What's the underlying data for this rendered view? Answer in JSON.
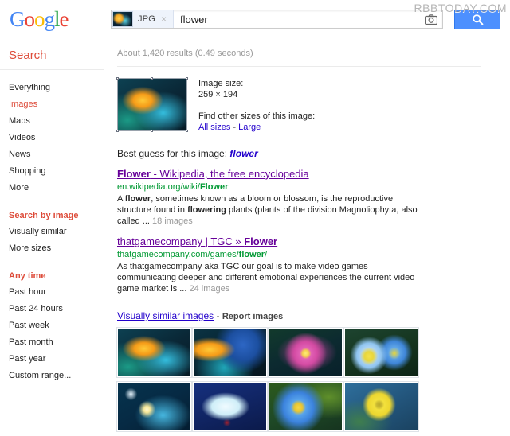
{
  "header": {
    "logo_text": "Google",
    "logo_letters": [
      {
        "ch": "G",
        "color": "#4285f4"
      },
      {
        "ch": "o",
        "color": "#ea4335"
      },
      {
        "ch": "o",
        "color": "#fbbc05"
      },
      {
        "ch": "g",
        "color": "#4285f4"
      },
      {
        "ch": "l",
        "color": "#34a853"
      },
      {
        "ch": "e",
        "color": "#ea4335"
      }
    ],
    "watermark": "RBBTODAY.COM",
    "search": {
      "chip_label": "JPG",
      "chip_close": "×",
      "query": "flower",
      "placeholder": "Search",
      "camera_icon": "camera-icon",
      "button_icon": "magnifier-icon",
      "button_color": "#4d90fe"
    }
  },
  "sidebar": {
    "heading": "Search",
    "nav_items": [
      {
        "label": "Everything",
        "active": false
      },
      {
        "label": "Images",
        "active": true
      },
      {
        "label": "Maps",
        "active": false
      },
      {
        "label": "Videos",
        "active": false
      },
      {
        "label": "News",
        "active": false
      },
      {
        "label": "Shopping",
        "active": false
      },
      {
        "label": "More",
        "active": false
      }
    ],
    "groups": [
      {
        "title": "Search by image",
        "items": [
          "Visually similar",
          "More sizes"
        ]
      },
      {
        "title": "Any time",
        "items": [
          "Past hour",
          "Past 24 hours",
          "Past week",
          "Past month",
          "Past year",
          "Custom range..."
        ]
      }
    ]
  },
  "main": {
    "result_stats": "About 1,420 results (0.49 seconds)",
    "image_card": {
      "size_label": "Image size:",
      "size_value": "259 × 194",
      "other_sizes_label": "Find other sizes of this image:",
      "all_sizes_link": "All sizes",
      "link_separator": " - ",
      "large_link": "Large"
    },
    "best_guess": {
      "label": "Best guess for this image:",
      "term": "flower"
    },
    "results": [
      {
        "title_prefix": "Flower",
        "title_rest": " - Wikipedia, the free encyclopedia",
        "url_plain": "en.wikipedia.org/wiki/",
        "url_bold": "Flower",
        "snippet_1": "A ",
        "snippet_b1": "flower",
        "snippet_2": ", sometimes known as a bloom or blossom, is the reproductive structure found in ",
        "snippet_b2": "flowering",
        "snippet_3": " plants (plants of the division Magnoliophyta, also called ... ",
        "image_count": "18 images"
      },
      {
        "title_prefix": "thatgamecompany | TGC » ",
        "title_rest": "Flower",
        "url_plain": "thatgamecompany.com/games/",
        "url_bold": "flower",
        "url_suffix": "/",
        "snippet_1": "As thatgamecompany aka TGC our goal is to make video games communicating deeper and different emotional experiences the current video game market is ... ",
        "image_count": "24 images"
      }
    ],
    "visually_similar": {
      "heading": "Visually similar images",
      "separator": " - ",
      "report_link": "Report images",
      "thumbnails": [
        {
          "alt": "bird-of-paradise flower",
          "style": "t1"
        },
        {
          "alt": "blue macaw with bird-of-paradise flower",
          "style": "t2"
        },
        {
          "alt": "pink lotus flower",
          "style": "t3"
        },
        {
          "alt": "blue and yellow pansies",
          "style": "t4"
        },
        {
          "alt": "glowing star burst artwork",
          "style": "t5"
        },
        {
          "alt": "white calla lily on blue",
          "style": "t6"
        },
        {
          "alt": "blue poppy flower",
          "style": "t7"
        },
        {
          "alt": "yellow sunflower on blue",
          "style": "t8"
        }
      ]
    }
  }
}
